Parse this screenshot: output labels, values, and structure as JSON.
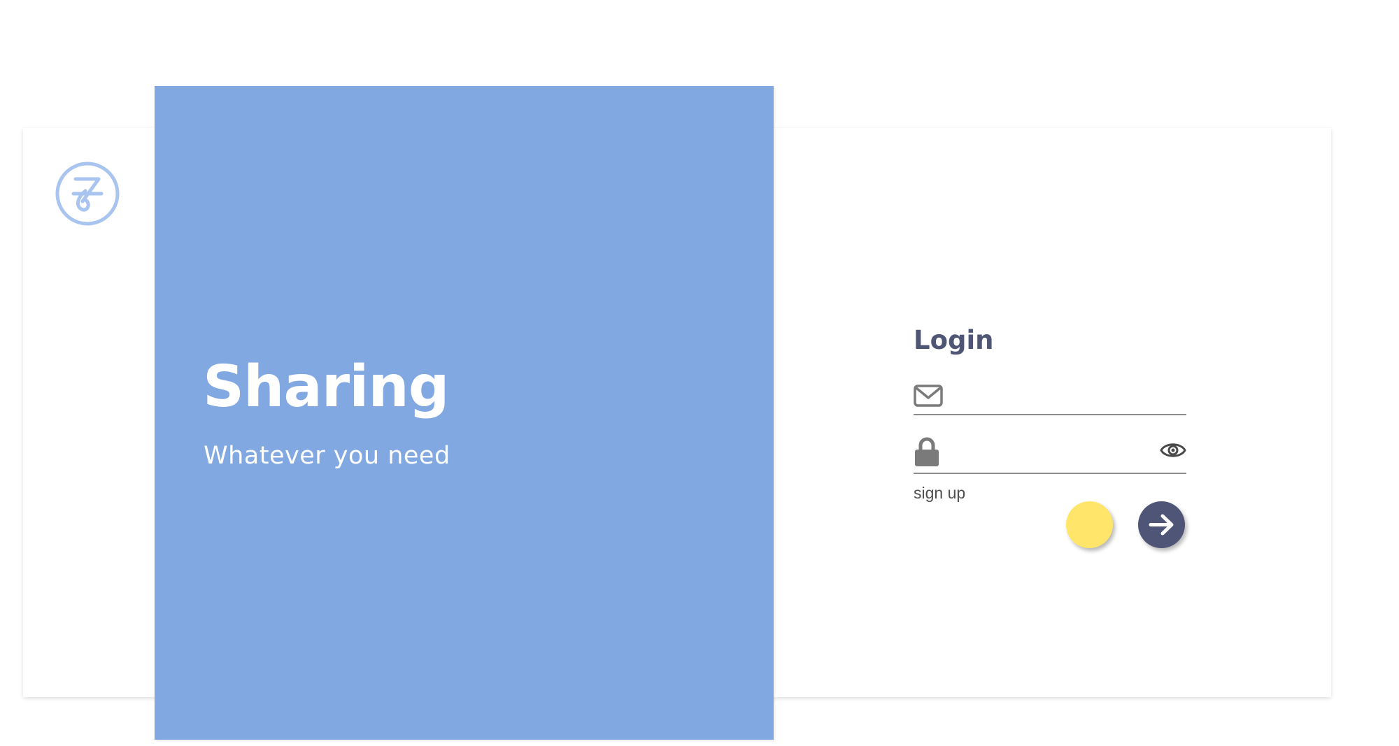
{
  "hero": {
    "title": "Sharing",
    "subtitle": "Whatever you need",
    "background_color": "#82a8e2"
  },
  "logo": {
    "icon": "brand-logo-icon",
    "color": "#a9c4ee"
  },
  "login": {
    "title": "Login",
    "email_icon": "envelope-icon",
    "email_value": "",
    "password_icon": "lock-icon",
    "password_value": "",
    "visibility_icon": "eye-icon",
    "signup_label": "sign up",
    "submit_icon": "arrow-right-icon",
    "accent_color": "#4f5577",
    "secondary_button_color": "#ffe66a"
  }
}
